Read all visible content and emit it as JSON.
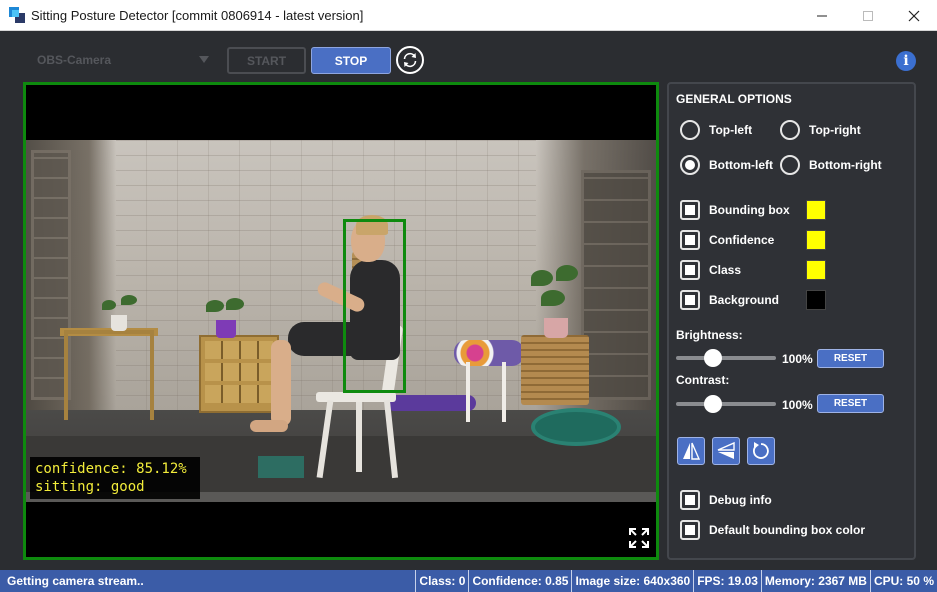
{
  "window": {
    "title": "Sitting Posture Detector [commit 0806914 - latest version]"
  },
  "toolbar": {
    "camera_value": "OBS-Camera",
    "start_label": "START",
    "stop_label": "STOP"
  },
  "video": {
    "overlay_confidence": "confidence: 85.12%",
    "overlay_status": "sitting: good",
    "bbox_color": "#0e8a0e"
  },
  "options": {
    "title": "GENERAL OPTIONS",
    "positions": [
      {
        "label": "Top-left",
        "selected": false
      },
      {
        "label": "Top-right",
        "selected": false
      },
      {
        "label": "Bottom-left",
        "selected": true
      },
      {
        "label": "Bottom-right",
        "selected": false
      }
    ],
    "toggles": [
      {
        "label": "Bounding box",
        "checked": true,
        "color": "#ffff00"
      },
      {
        "label": "Confidence",
        "checked": true,
        "color": "#ffff00"
      },
      {
        "label": "Class",
        "checked": true,
        "color": "#ffff00"
      },
      {
        "label": "Background",
        "checked": true,
        "color": "#000000"
      }
    ],
    "brightness": {
      "label": "Brightness:",
      "value": "100%",
      "level": 0.37,
      "reset_label": "RESET"
    },
    "contrast": {
      "label": "Contrast:",
      "value": "100%",
      "level": 0.37,
      "reset_label": "RESET"
    },
    "debug": {
      "label": "Debug info",
      "checked": true
    },
    "default_bbox": {
      "label": "Default bounding box color",
      "checked": true
    }
  },
  "status": {
    "message": "Getting camera stream..",
    "class": "Class: 0",
    "confidence": "Confidence: 0.85",
    "image_size": "Image size: 640x360",
    "fps": "FPS: 19.03",
    "memory": "Memory: 2367 MB",
    "cpu": "CPU: 50 %"
  },
  "colors": {
    "accent": "#4a6fc4",
    "status_bar": "#3b5ca7",
    "frame_green": "#0e8a0e",
    "overlay_text": "#f2ec3a"
  },
  "icons": [
    "app-icon",
    "minimize-icon",
    "maximize-icon",
    "close-icon",
    "chevron-down-icon",
    "refresh-icon",
    "info-icon",
    "fullscreen-icon",
    "flip-horizontal-icon",
    "flip-vertical-icon",
    "rotate-icon"
  ]
}
